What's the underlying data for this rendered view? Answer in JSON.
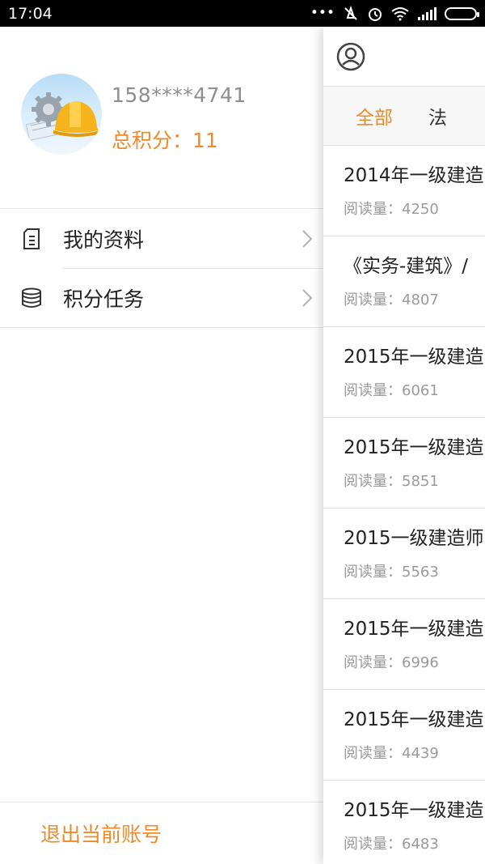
{
  "status_bar": {
    "time": "17:04",
    "icons": [
      "dots-icon",
      "mute-icon",
      "alarm-icon",
      "wifi-icon",
      "signal-icon",
      "battery-icon"
    ]
  },
  "drawer": {
    "phone": "158****4741",
    "points_label": "总积分：11",
    "menu": [
      {
        "label": "我的资料",
        "icon": "document-icon"
      },
      {
        "label": "积分任务",
        "icon": "database-icon"
      }
    ],
    "logout": "退出当前账号"
  },
  "content": {
    "header_icon": "user-icon",
    "tabs": [
      {
        "label": "全部",
        "active": true
      },
      {
        "label": "法",
        "active": false
      }
    ],
    "articles": [
      {
        "title": "2014年一级建造",
        "meta": "阅读量：4250"
      },
      {
        "title": "《实务-建筑》/",
        "meta": "阅读量：4807"
      },
      {
        "title": "2015年一级建造",
        "meta": "阅读量：6061"
      },
      {
        "title": "2015年一级建造",
        "meta": "阅读量：5851"
      },
      {
        "title": "2015一级建造师",
        "meta": "阅读量：5563"
      },
      {
        "title": "2015年一级建造",
        "meta": "阅读量：6996"
      },
      {
        "title": "2015年一级建造",
        "meta": "阅读量：4439"
      },
      {
        "title": "2015年一级建造",
        "meta": "阅读量：6483"
      }
    ]
  },
  "colors": {
    "accent": "#ef8a2a",
    "status_bar": "#000000",
    "divider": "#e6e6e6"
  }
}
